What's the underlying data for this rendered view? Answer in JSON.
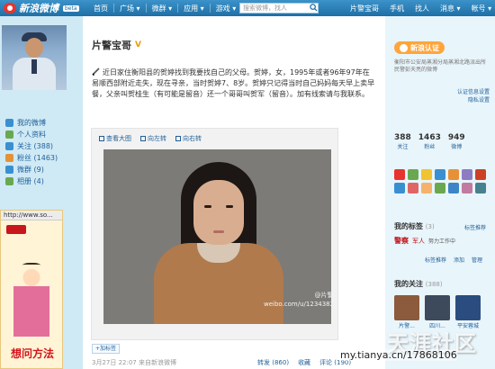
{
  "brand": {
    "logo_text": "新浪微博",
    "beta": "beta"
  },
  "nav": {
    "items": [
      "首页",
      "广场 ▾",
      "微群 ▾",
      "应用 ▾",
      "游戏 ▾"
    ],
    "search_placeholder": "搜索微博，找人",
    "right_items": [
      "片警宝哥",
      "手机",
      "找人",
      "消息 ▾",
      "帐号 ▾"
    ]
  },
  "sidebar": {
    "menu": [
      {
        "label": "我的微博",
        "icon": "home-icon",
        "color": "#3a8fd1"
      },
      {
        "label": "个人资料",
        "icon": "profile-icon",
        "color": "#6aa84f"
      },
      {
        "label": "关注 (388)",
        "icon": "follow-icon",
        "color": "#3a8fd1"
      },
      {
        "label": "粉丝 (1463)",
        "icon": "fans-icon",
        "color": "#e69138"
      },
      {
        "label": "微群 (9)",
        "icon": "group-icon",
        "color": "#3a8fd1"
      },
      {
        "label": "相册 (4)",
        "icon": "album-icon",
        "color": "#6aa84f"
      }
    ],
    "ad": {
      "url_bar": "http://www.so...",
      "title": "想问方法"
    }
  },
  "main": {
    "username": "片警宝哥",
    "verified_mark": "V",
    "post_text": "近日家住衡阳县的贺婷找到我要找自己的父母。贺婷，女，1995年或者96年97年在易顺西部附近走失，现在寻亲，当时贺婷7、8岁。贺婷只记得当时自己妈妈每天早上卖早餐，父亲叫贺桂生（有可能是留音）还一个哥哥叫贺军（留音）。加有线索请与我联系。",
    "photo_tools": [
      "查看大图",
      "向左转",
      "向右转"
    ],
    "watermark": [
      "@片警宝哥",
      "weibo.com/u/1234382901"
    ],
    "tag_button": "+加标签",
    "meta": "3月27日 22:07 来自新浪微博",
    "actions": [
      "转发 (860)",
      "收藏",
      "评论 (190)"
    ]
  },
  "right": {
    "verify_label": "新浪认证",
    "verify_desc": "衡阳市公安局蒸湘分局蒸湘北路派出所民警彭天亮的微博",
    "settings_links": [
      "认证信息设置",
      "隐私设置"
    ],
    "stats": [
      {
        "num": "388",
        "label": "关注"
      },
      {
        "num": "1463",
        "label": "粉丝"
      },
      {
        "num": "949",
        "label": "微博"
      }
    ],
    "app_colors": [
      "#e8342f",
      "#6aa84f",
      "#f1c232",
      "#3a8fd1",
      "#e69138",
      "#8e7cc3",
      "#cc4125",
      "#3a8fd1",
      "#e06666",
      "#f6b26b",
      "#6aa84f",
      "#3d85c6",
      "#c27ba0",
      "#45818e"
    ],
    "tags_title": "我的标签",
    "tags_count": "(3)",
    "tags_link": "标签推荐",
    "tags": [
      "警察",
      "军人",
      "努力工作中"
    ],
    "tag_actions": [
      "标签推荐",
      "添加",
      "管理"
    ],
    "follows_title": "我的关注",
    "follows_count": "(388)",
    "follows": [
      {
        "name": "片警...",
        "color": "#8c5a3c"
      },
      {
        "name": "四川...",
        "color": "#3d4a5c"
      },
      {
        "name": "平安蓉城",
        "color": "#2b4c7e"
      }
    ]
  },
  "overlay": {
    "site": "天涯社区",
    "url": "my.tianya.cn/17868106"
  }
}
